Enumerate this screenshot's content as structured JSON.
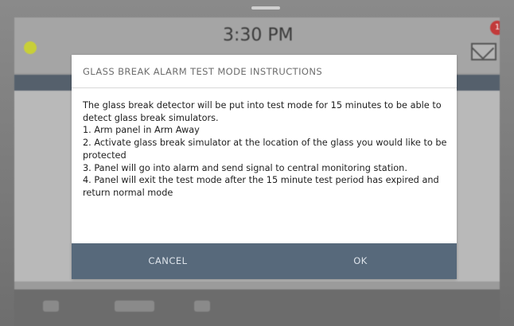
{
  "status_bar": {
    "time": "3:30 PM"
  },
  "notifications": {
    "badge_count": "1"
  },
  "dialog": {
    "title": "GLASS BREAK ALARM TEST MODE INSTRUCTIONS",
    "body_lines": [
      "The glass break detector will be put into test mode for 15 minutes to be able to detect glass break simulators.",
      "1. Arm panel in Arm Away",
      "2. Activate glass break simulator at the location of the glass you would like to be protected",
      "3. Panel will go into alarm and send signal to central monitoring station.",
      "4. Panel will exit the test mode after the 15 minute test period has expired and return normal mode"
    ],
    "cancel_label": "CANCEL",
    "ok_label": "OK"
  },
  "colors": {
    "dialog_button_bar": "#57697b",
    "weather_icon": "#c8cf38",
    "badge": "#c23a3a"
  }
}
